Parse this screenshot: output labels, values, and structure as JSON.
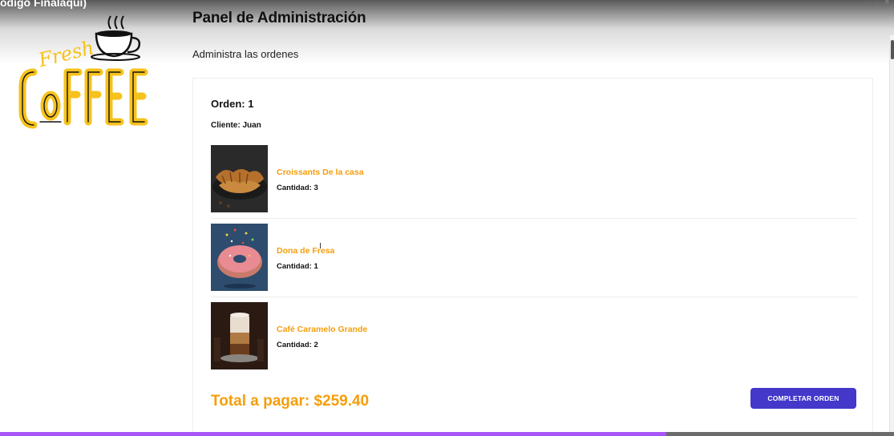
{
  "caption": "odigo Finalaqui)",
  "header": {
    "title": "Panel de Administración",
    "subtitle": "Administra las ordenes"
  },
  "logo": {
    "word_top": "Fresh",
    "word_main": "COFFEE",
    "colors": {
      "yellow": "#f6c21c",
      "orange": "#f59e0b"
    },
    "icon": "coffee-cup-icon"
  },
  "order": {
    "id_label": "Orden: 1",
    "client_label": "Cliente: Juan",
    "products": [
      {
        "name": "Croissants De la casa",
        "quantity": "Cantidad: 3",
        "image": "croissant-photo"
      },
      {
        "name": "Dona de Fresa",
        "quantity": "Cantidad: 1",
        "image": "donut-photo"
      },
      {
        "name": "Café Caramelo Grande",
        "quantity": "Cantidad: 2",
        "image": "latte-photo"
      }
    ],
    "total_label": "Total a pagar: $259.40",
    "complete_button": "COMPLETAR ORDEN"
  },
  "video": {
    "progress": 0.745,
    "progress_color": "#a855f7"
  },
  "colors": {
    "accent_orange": "#f59e0b",
    "button_indigo": "#4338ca"
  }
}
